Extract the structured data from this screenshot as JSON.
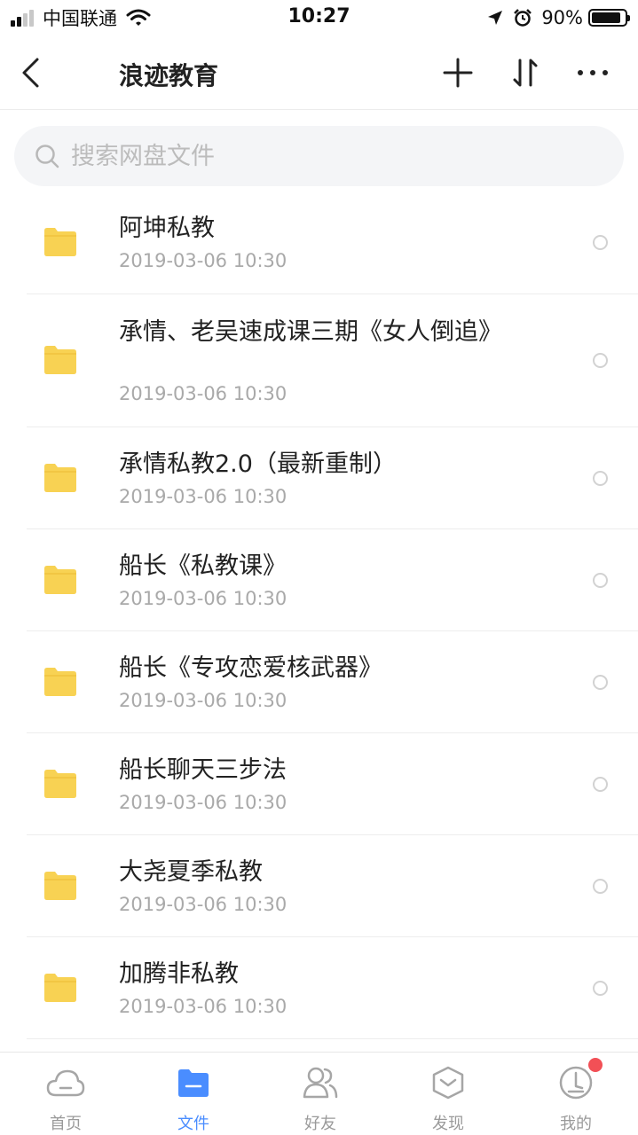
{
  "status_bar": {
    "carrier": "中国联通",
    "time": "10:27",
    "battery": "90%",
    "battery_level": 0.9
  },
  "nav": {
    "title": "浪迹教育"
  },
  "search": {
    "placeholder": "搜索网盘文件"
  },
  "files": [
    {
      "name": "阿坤私教",
      "date": "2019-03-06 10:30"
    },
    {
      "name": "承情、老吴速成课三期《女人倒追》",
      "date": "2019-03-06 10:30"
    },
    {
      "name": "承情私教2.0（最新重制）",
      "date": "2019-03-06 10:30"
    },
    {
      "name": "船长《私教课》",
      "date": "2019-03-06 10:30"
    },
    {
      "name": "船长《专攻恋爱核武器》",
      "date": "2019-03-06 10:30"
    },
    {
      "name": "船长聊天三步法",
      "date": "2019-03-06 10:30"
    },
    {
      "name": "大尧夏季私教",
      "date": "2019-03-06 10:30"
    },
    {
      "name": "加腾非私教",
      "date": "2019-03-06 10:30"
    }
  ],
  "tabs": [
    {
      "label": "首页",
      "icon": "cloud-icon"
    },
    {
      "label": "文件",
      "icon": "folder-icon"
    },
    {
      "label": "好友",
      "icon": "friends-icon"
    },
    {
      "label": "发现",
      "icon": "discover-icon"
    },
    {
      "label": "我的",
      "icon": "profile-icon"
    }
  ],
  "colors": {
    "accent": "#4a8dff",
    "folder": "#f8d253",
    "badge": "#f25056"
  }
}
